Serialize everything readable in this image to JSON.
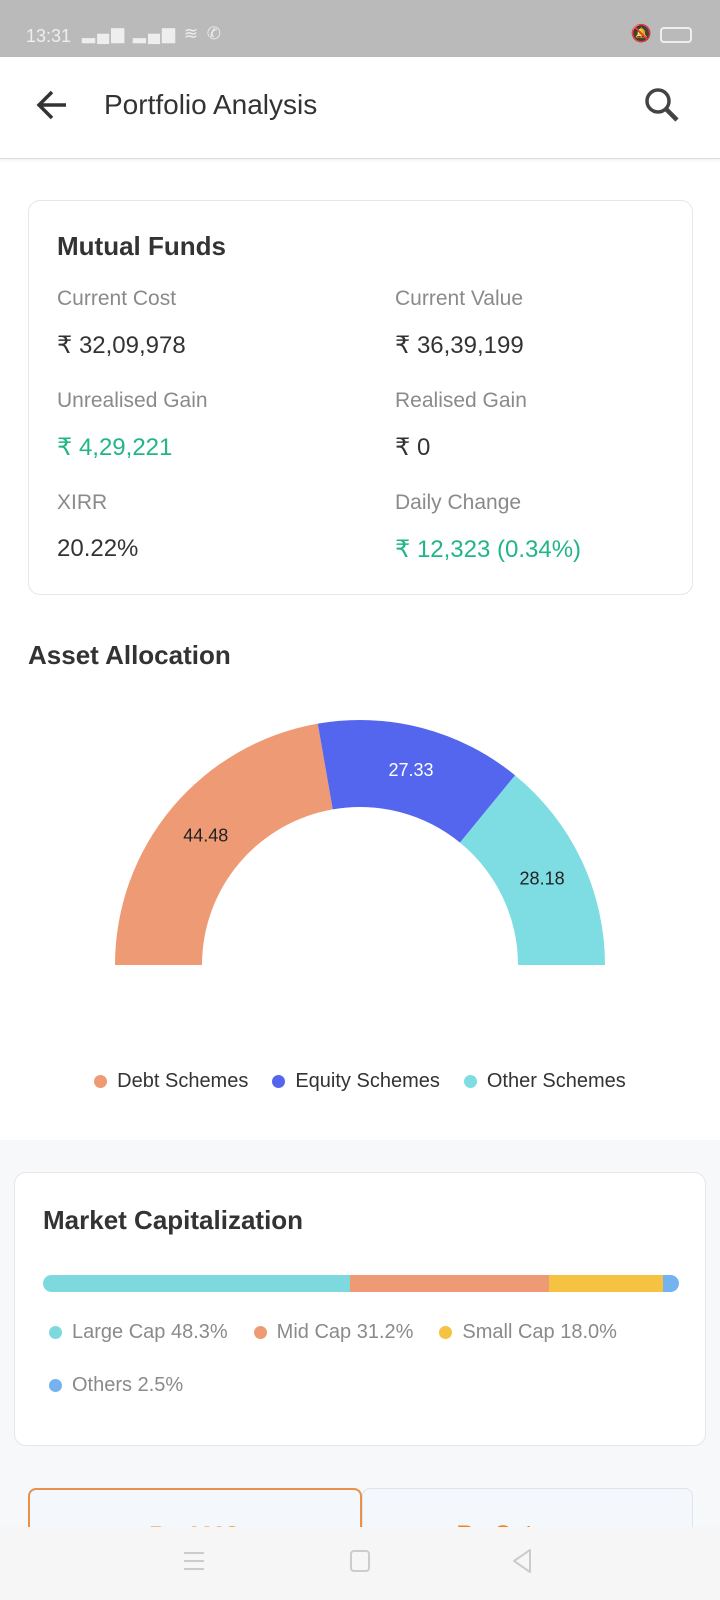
{
  "status": {
    "time": "13:31"
  },
  "header": {
    "title": "Portfolio Analysis"
  },
  "mutual_funds": {
    "title": "Mutual Funds",
    "items": [
      {
        "label": "Current Cost",
        "value": "₹ 32,09,978",
        "positive": false
      },
      {
        "label": "Current Value",
        "value": "₹ 36,39,199",
        "positive": false
      },
      {
        "label": "Unrealised Gain",
        "value": "₹ 4,29,221",
        "positive": true
      },
      {
        "label": "Realised Gain",
        "value": "₹ 0",
        "positive": false
      },
      {
        "label": "XIRR",
        "value": "20.22%",
        "positive": false
      },
      {
        "label": "Daily Change",
        "value": "₹ 12,323 (0.34%)",
        "positive": true
      }
    ]
  },
  "asset_allocation": {
    "title": "Asset Allocation"
  },
  "chart_data": {
    "type": "pie",
    "subtype": "semi-donut",
    "categories": [
      "Debt Schemes",
      "Equity Schemes",
      "Other Schemes"
    ],
    "values": [
      44.48,
      27.33,
      28.18
    ],
    "labels": [
      "44.48",
      "27.33",
      "28.18"
    ],
    "colors": [
      "#ee9a74",
      "#5566ee",
      "#7edde2"
    ],
    "legend": "bottom"
  },
  "market_cap": {
    "title": "Market Capitalization",
    "segments": [
      {
        "label": "Large Cap 48.3%",
        "value": 48.3,
        "color": "#7ed9de"
      },
      {
        "label": "Mid Cap 31.2%",
        "value": 31.2,
        "color": "#ee9a74"
      },
      {
        "label": "Small Cap 18.0%",
        "value": 18.0,
        "color": "#f5c242"
      },
      {
        "label": "Others 2.5%",
        "value": 2.5,
        "color": "#74b3f0"
      }
    ]
  },
  "tabs": [
    {
      "label": "By AMC",
      "active": true
    },
    {
      "label": "By Category",
      "active": false
    }
  ]
}
